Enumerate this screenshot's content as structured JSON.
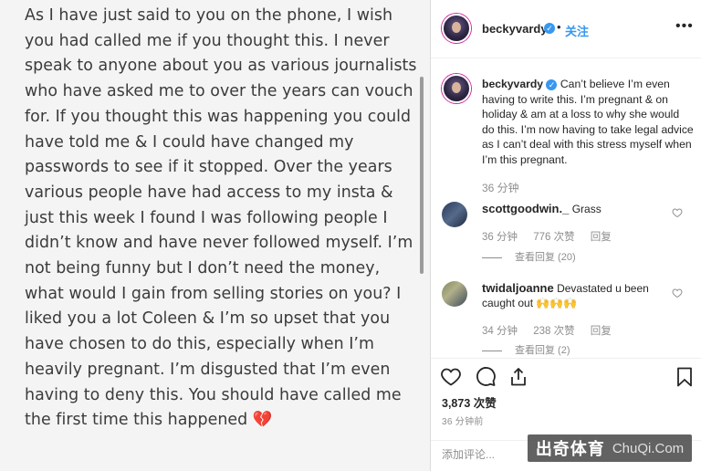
{
  "note": {
    "text": "As I have just said to you on the phone, I wish you had called me if you thought this. I never speak to anyone about you as various journalists who have asked me to over the years can vouch for. If you thought this was happening you could have told me & I could have changed my passwords to see if it stopped. Over the years various people have had access to my insta & just this week I found I was following people I didn’t know and have never followed myself. I’m not being funny but I don’t need the money, what would I gain from selling stories on you? I liked you a lot Coleen & I’m so upset that you have chosen to do this, especially when I’m heavily pregnant. I’m disgusted that I’m even having to deny this. You should have called me the first time this happened 💔"
  },
  "header": {
    "username": "beckyvardy",
    "separator": "•",
    "follow_label": "关注",
    "more_label": "•••"
  },
  "caption": {
    "username": "beckyvardy",
    "text": "Can’t believe I’m even having to write this. I’m pregnant & on holiday & am at a loss to why she would do this. I’m now having to take legal advice as I can’t deal with this stress myself when I’m this pregnant.",
    "time": "36 分钟"
  },
  "comments": [
    {
      "username": "scottgoodwin._",
      "text": "Grass",
      "time": "36 分钟",
      "likes": "776 次赞",
      "reply_label": "回复",
      "view_replies": "查看回复 (20)"
    },
    {
      "username": "twidaljoanne",
      "text": "Devastated u been caught out",
      "emoji": "🙌🙌🙌",
      "time": "34 分钟",
      "likes": "238 次赞",
      "reply_label": "回复",
      "view_replies": "查看回复 (2)"
    }
  ],
  "actions": {
    "likes_count": "3,873 次赞",
    "post_time": "36 分钟前"
  },
  "add_comment": {
    "placeholder": "添加评论..."
  },
  "watermark": {
    "cn": "出奇体育",
    "en": "ChuQi.Com"
  },
  "colors": {
    "link_blue": "#3897f0",
    "text": "#262626",
    "muted": "#8e8e8e",
    "border": "#efefef"
  },
  "icons": [
    "verified-badge-icon",
    "more-options-icon",
    "heart-icon",
    "comment-icon",
    "share-icon",
    "bookmark-icon"
  ]
}
